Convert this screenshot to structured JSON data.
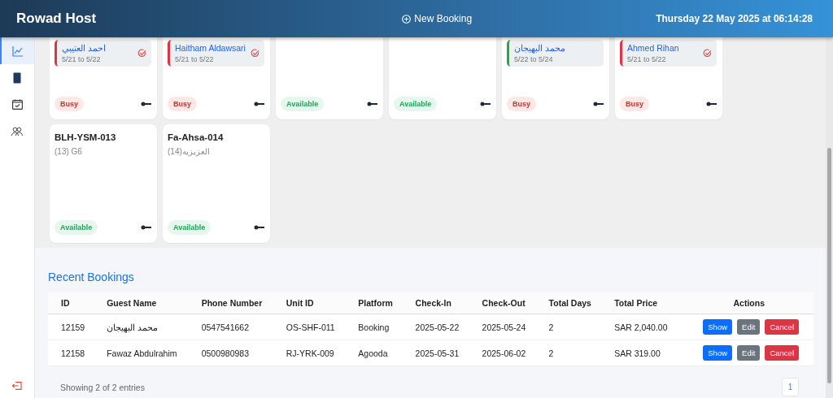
{
  "header": {
    "brand": "Rowad Host",
    "new_booking": "New Booking",
    "datetime": "Thursday 22 May 2025 at 06:14:28"
  },
  "sidebar": {
    "items": [
      {
        "kind": "chart",
        "selected": true
      },
      {
        "kind": "tablet",
        "selected": false
      },
      {
        "kind": "calendar",
        "selected": false
      },
      {
        "kind": "users",
        "selected": false
      }
    ],
    "logout": true
  },
  "units": [
    {
      "booking": {
        "guest": "احمد العتيبي",
        "dates": "5/21 to 5/22",
        "color": "#dc3545",
        "checked": true
      },
      "status": {
        "label": "Busy",
        "kind": "busy"
      }
    },
    {
      "booking": {
        "guest": "Haitham Aldawsari",
        "dates": "5/21 to 5/22",
        "color": "#dc3545",
        "checked": true
      },
      "status": {
        "label": "Busy",
        "kind": "busy"
      }
    },
    {
      "status": {
        "label": "Available",
        "kind": "available"
      }
    },
    {
      "status": {
        "label": "Available",
        "kind": "available"
      }
    },
    {
      "booking": {
        "guest": "محمد البهيجان",
        "dates": "5/22 to 5/24",
        "color": "#28a745",
        "checked": false
      },
      "status": {
        "label": "Busy",
        "kind": "busy"
      }
    },
    {
      "booking": {
        "guest": "Ahmed Rihan",
        "dates": "5/21 to 5/22",
        "color": "#dc3545",
        "checked": true
      },
      "status": {
        "label": "Busy",
        "kind": "busy"
      }
    },
    {
      "name": "BLH-YSM-013",
      "subtitle": "(13) G6",
      "status": {
        "label": "Available",
        "kind": "available"
      }
    },
    {
      "name": "Fa-Ahsa-014",
      "subtitle": "العزيزيه(14)",
      "status": {
        "label": "Available",
        "kind": "available"
      }
    }
  ],
  "recent_bookings": {
    "title": "Recent Bookings",
    "columns": [
      "ID",
      "Guest Name",
      "Phone Number",
      "Unit ID",
      "Platform",
      "Check-In",
      "Check-Out",
      "Total Days",
      "Total Price",
      "Actions"
    ],
    "rows": [
      {
        "cells": [
          "12159",
          "محمد البهيجان",
          "0547541662",
          "OS-SHF-011",
          "Booking",
          "2025-05-22",
          "2025-05-24",
          "2",
          "SAR 2,040.00"
        ],
        "actions": [
          "Show",
          "Edit",
          "Cancel"
        ]
      },
      {
        "cells": [
          "12158",
          "Fawaz Abdulrahim",
          "0500980983",
          "RJ-YRK-009",
          "Agooda",
          "2025-05-31",
          "2025-06-02",
          "2",
          "SAR 319.00"
        ],
        "actions": [
          "Show",
          "Edit",
          "Cancel"
        ]
      }
    ],
    "footer": "Showing 2 of 2 entries",
    "pages": [
      {
        "label": "1",
        "selected": true
      }
    ]
  }
}
